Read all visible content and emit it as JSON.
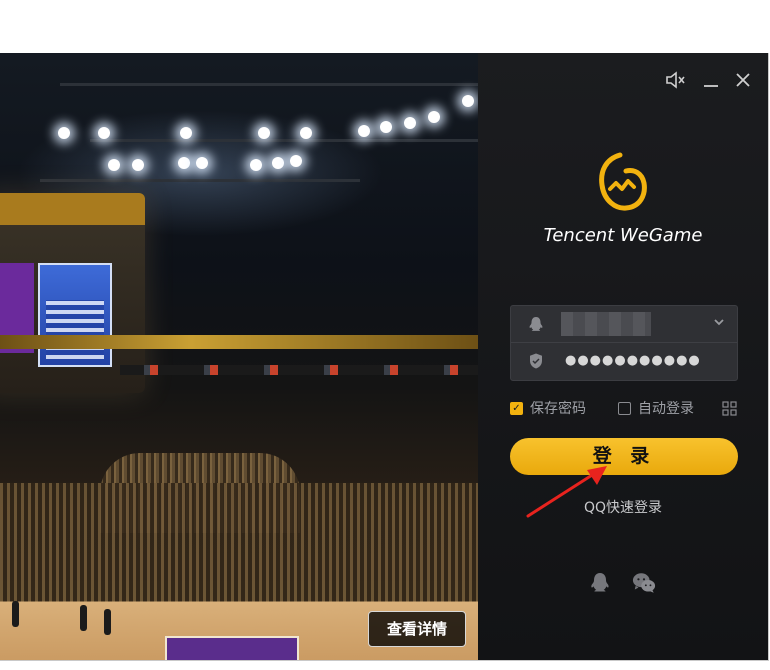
{
  "window": {
    "controls": {
      "mute_icon": "speaker-mute-icon",
      "minimize_icon": "minimize-icon",
      "close_icon": "close-icon"
    }
  },
  "banner": {
    "detail_button": "查看详情"
  },
  "login": {
    "brand": "Tencent WeGame",
    "password_mask": "●●●●●●●●●●●",
    "remember_password": {
      "label": "保存密码",
      "checked": true
    },
    "auto_login": {
      "label": "自动登录",
      "checked": false
    },
    "login_button": "登 录",
    "qq_fast_login": "QQ快速登录",
    "social_icons": [
      "qq-icon",
      "wechat-icon"
    ]
  },
  "colors": {
    "accent": "#f2b20f",
    "panel_bg": "#1b1c1f",
    "annotation_arrow": "#e8231e"
  }
}
